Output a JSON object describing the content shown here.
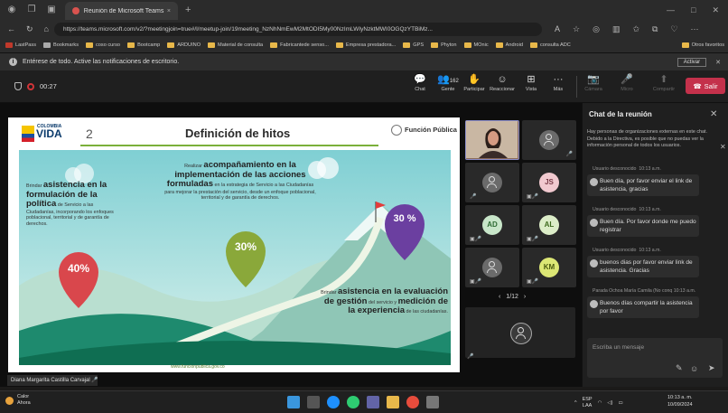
{
  "browser": {
    "tab_title": "Reunión de Microsoft Teams",
    "new_tab": "+",
    "window_buttons": [
      "—",
      "□",
      "✕"
    ],
    "url": "https://teams.microsoft.com/v2/?meetingjoin=true#/l/meetup-join/19meeting_NzNhNmEwM2MtODI5My00NzImLWIyNzktMWI0OGQzYTBiMz...",
    "bookmarks": [
      "LastPass",
      "Bookmarks",
      "coso curso",
      "Bootcamp",
      "ARDUINO",
      "Material de consulta",
      "Fabricantede senso...",
      "Empresa prestadora...",
      "GPS",
      "Phyton",
      "MOnic",
      "Android",
      "consulta ADC"
    ],
    "other_bookmarks": "Otros favoritos"
  },
  "notification": {
    "text": "Entérese de todo. Active las notificaciones de escritorio.",
    "button": "Activar"
  },
  "meeting": {
    "timer": "00:27",
    "toolbar": [
      {
        "id": "chat",
        "icon": "chat-icon",
        "glyph": "💬",
        "label": "Chat"
      },
      {
        "id": "people",
        "icon": "people-icon",
        "glyph": "👥",
        "label": "Gente",
        "count": "162"
      },
      {
        "id": "raise",
        "icon": "hand-icon",
        "glyph": "✋",
        "label": "Participar"
      },
      {
        "id": "react",
        "icon": "smile-icon",
        "glyph": "☺",
        "label": "Reaccionar"
      },
      {
        "id": "view",
        "icon": "grid-icon",
        "glyph": "⊞",
        "label": "Vista"
      },
      {
        "id": "more",
        "icon": "more-icon",
        "glyph": "···",
        "label": "Más"
      }
    ],
    "media": [
      {
        "id": "camera",
        "label": "Cámara",
        "glyph": "📷"
      },
      {
        "id": "mic",
        "label": "Micro",
        "glyph": "🎤"
      },
      {
        "id": "share",
        "label": "Compartir",
        "glyph": "⬆"
      }
    ],
    "leave": "Salir",
    "page": "1/12",
    "presenter": "Diana Margarita Castilla Carvajal"
  },
  "slide": {
    "logo_country": "COLOMBIA",
    "logo_text": "VIDA",
    "page_number": "2",
    "title": "Definición de hitos",
    "org": "Función Pública",
    "blocks": [
      {
        "pre": "Brindar ",
        "bold": "asistencia en la formulación de la política",
        "post": " de Servicio a las Ciudadanías, incorporando los enfoques poblacional, territorial y de garantía de derechos."
      },
      {
        "pre": "Realizar ",
        "bold": "acompañamiento en la implementación de las acciones formuladas",
        "post": " en la estrategia de Servicio a las Ciudadanías para mejorar la prestación del servicio, desde un enfoque poblacional, territorial y de garantía de derechos."
      },
      {
        "pre": "Brindar ",
        "bold": "asistencia en la evaluación de gestión",
        "post": " del servicio y ",
        "bold2": "medición de la experiencia",
        "post2": " de las ciudadanías."
      }
    ],
    "percents": [
      "40%",
      "30%",
      "30 %"
    ],
    "footer": "www.funcionpublica.gov.co"
  },
  "participants": [
    {
      "initials": ""
    },
    {
      "initials": ""
    },
    {
      "initials": ""
    },
    {
      "initials": "JS"
    },
    {
      "initials": "AD"
    },
    {
      "initials": "AL"
    },
    {
      "initials": ""
    },
    {
      "initials": "KM"
    }
  ],
  "chat": {
    "title": "Chat de la reunión",
    "notice": "Hay personas de organizaciones externas en este chat. Debido a la Directiva, es posible que no puedas ver la información personal de todos los usuarios.",
    "messages": [
      {
        "author": "Usuario desconocido",
        "time": "10:13 a.m.",
        "text": "Buen día, por favor enviar el link de asistencia, gracias"
      },
      {
        "author": "Usuario desconocido",
        "time": "10:13 a.m.",
        "text": "Buen día. Por favor donde me puedo registrar"
      },
      {
        "author": "Usuario desconocido",
        "time": "10:13 a.m.",
        "text": "buenos dias por favor enviar link de asistencia. Gracias"
      },
      {
        "author": "Parada Ochoa María Camila (No conq",
        "time": "10:13 a.m.",
        "text": "Buenos días compartir la asistencia por favor"
      }
    ],
    "placeholder": "Escriba un mensaje"
  },
  "taskbar": {
    "weather": "Calor",
    "weather_sub": "Ahora",
    "lang": "ESP",
    "lang_sub": "LAA",
    "time": "10:13 a. m.",
    "date": "10/09/2024"
  }
}
